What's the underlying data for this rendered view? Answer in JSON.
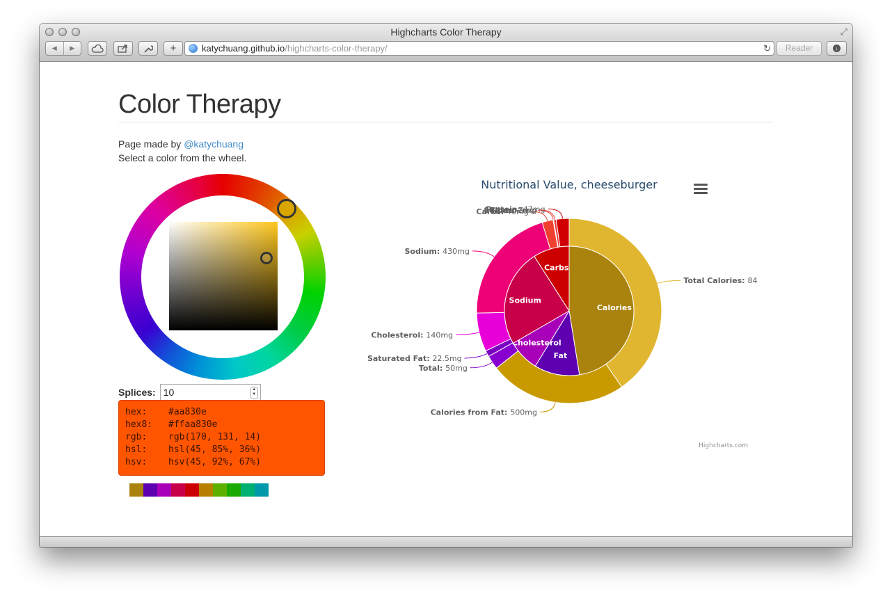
{
  "window": {
    "title": "Highcharts Color Therapy",
    "url_host": "katychuang.github.io",
    "url_path": "/highcharts-color-therapy/",
    "reader_label": "Reader"
  },
  "page": {
    "title": "Color Therapy",
    "made_by_prefix": "Page made by",
    "made_by_link": "@katychuang",
    "instruction": "Select a color from the wheel.",
    "splices_label": "Splices:",
    "splices_value": "10",
    "color_info": [
      {
        "key": "hex:",
        "value": "#aa830e"
      },
      {
        "key": "hex8:",
        "value": "#ffaa830e"
      },
      {
        "key": "rgb:",
        "value": "rgb(170, 131, 14)"
      },
      {
        "key": "hsl:",
        "value": "hsl(45, 85%, 36%)"
      },
      {
        "key": "hsv:",
        "value": "hsv(45, 92%, 67%)"
      }
    ],
    "swatches": [
      "#aa830e",
      "#5e00b0",
      "#a800b8",
      "#c8004a",
      "#cc0000",
      "#b88000",
      "#5eb000",
      "#1aaa00",
      "#00b070",
      "#0099aa"
    ]
  },
  "chart_data": {
    "type": "pie",
    "title": "Nutritional Value, cheeseburger",
    "credits": "Highcharts.com",
    "inner": {
      "labels": [
        "Calories",
        "Fat",
        "Cholesterol",
        "Sodium",
        "Carbs"
      ],
      "values": [
        840,
        200,
        140,
        430,
        160
      ],
      "colors": [
        "#aa830e",
        "#5e00b0",
        "#a800b8",
        "#c8004a",
        "#cc0000"
      ]
    },
    "outer": {
      "labels": [
        "Total Calories:",
        "Calories from Fat:",
        "Total:",
        "Saturated Fat:",
        "Cholesterol:",
        "Sodium:",
        "Carbs:",
        "Fiber:",
        "Sugars:",
        "Protein:"
      ],
      "values_text": [
        "84",
        "500mg",
        "50mg",
        "22.5mg",
        "140mg",
        "430mg",
        "40mg",
        "2mg",
        "9mg",
        "47mg"
      ],
      "values": [
        840,
        500,
        50,
        22.5,
        140,
        430,
        40,
        2,
        9,
        47
      ],
      "colors": [
        "#e0b630",
        "#c99a00",
        "#8800d0",
        "#7a00c0",
        "#e800d8",
        "#ee0077",
        "#f04030",
        "#f04a3a",
        "#ee3838",
        "#d00000"
      ]
    }
  }
}
